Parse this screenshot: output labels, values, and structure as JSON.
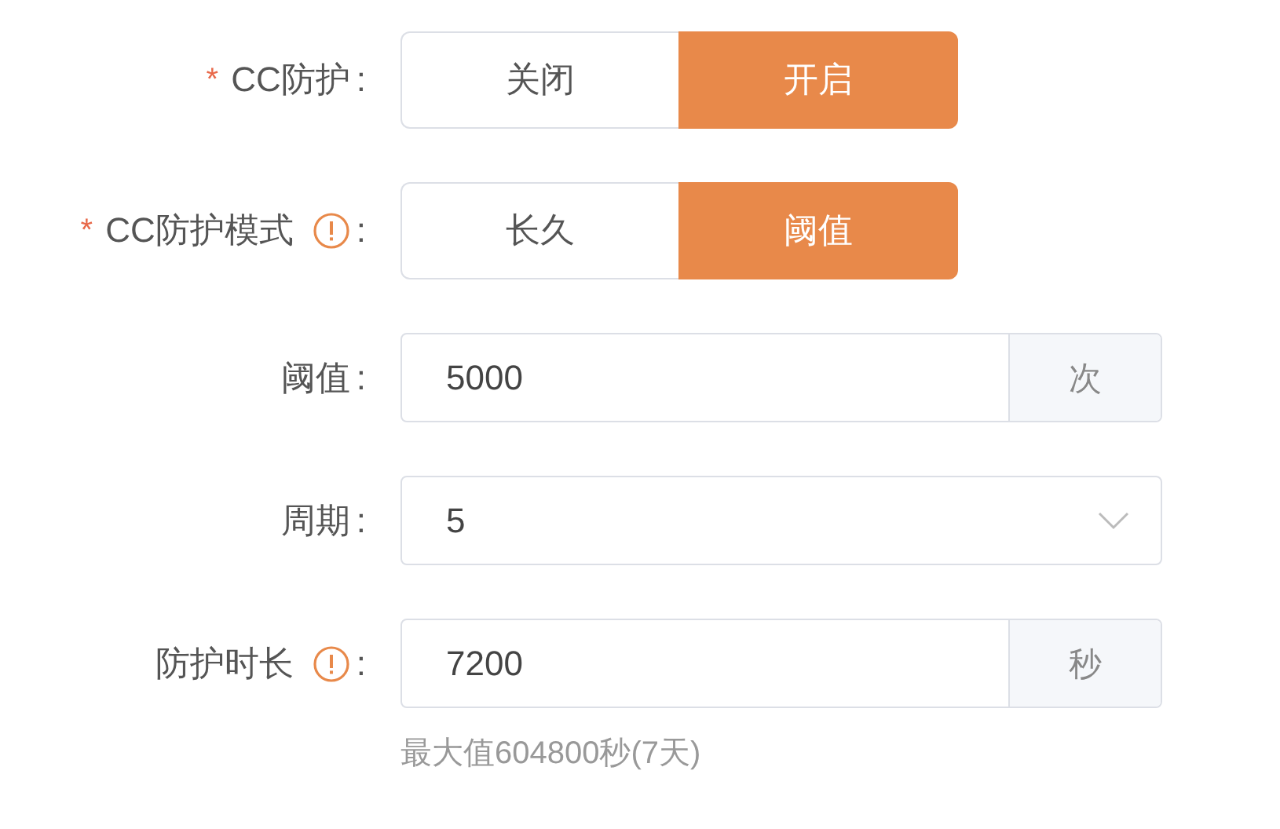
{
  "fields": [
    {
      "kind": "toggle",
      "required_mark": "*",
      "label": "CC防护",
      "info": false,
      "colon": ":",
      "options": [
        {
          "label": "关闭",
          "selected": false
        },
        {
          "label": "开启",
          "selected": true
        }
      ]
    },
    {
      "kind": "toggle",
      "required_mark": "*",
      "label": "CC防护模式",
      "info": true,
      "colon": ":",
      "options": [
        {
          "label": "长久",
          "selected": false
        },
        {
          "label": "阈值",
          "selected": true
        }
      ]
    },
    {
      "kind": "input",
      "label": "阈值",
      "info": false,
      "colon": ":",
      "value": "5000",
      "suffix": "次"
    },
    {
      "kind": "select",
      "label": "周期",
      "info": false,
      "colon": ":",
      "value": "5"
    },
    {
      "kind": "input",
      "label": "防护时长",
      "info": true,
      "colon": ":",
      "value": "7200",
      "suffix": "秒",
      "hint": "最大值604800秒(7天)"
    }
  ]
}
